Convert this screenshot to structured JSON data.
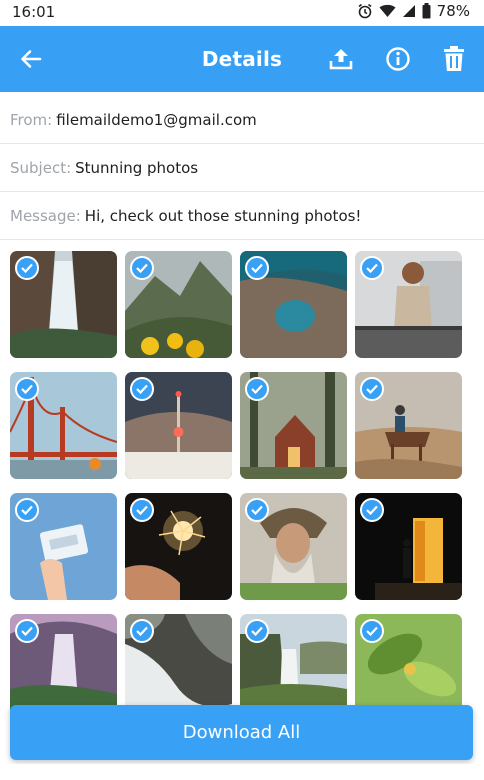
{
  "status_bar": {
    "time": "16:01",
    "battery": "78%",
    "icons": [
      "alarm-icon",
      "wifi-icon",
      "signal-icon",
      "battery-icon"
    ]
  },
  "app_bar": {
    "title": "Details",
    "background": "#37a0f4",
    "icons": [
      "back-arrow-icon",
      "upload-icon",
      "info-icon",
      "trash-icon"
    ]
  },
  "details": {
    "from_label": "From:",
    "from_value": "filemaildemo1@gmail.com",
    "subject_label": "Subject:",
    "subject_value": "Stunning photos",
    "message_label": "Message:",
    "message_value": "Hi, check out those stunning photos!"
  },
  "photos": [
    {
      "subject": "waterfall canyon",
      "selected": true
    },
    {
      "subject": "machu picchu",
      "selected": true
    },
    {
      "subject": "coastal lagoon aerial",
      "selected": true
    },
    {
      "subject": "woman on bridge",
      "selected": true
    },
    {
      "subject": "golden gate bridge",
      "selected": true
    },
    {
      "subject": "tower at dusk",
      "selected": true
    },
    {
      "subject": "cabin in forest",
      "selected": true
    },
    {
      "subject": "horse rider desert",
      "selected": true
    },
    {
      "subject": "hand holding cassette",
      "selected": true
    },
    {
      "subject": "sparkler",
      "selected": true
    },
    {
      "subject": "bearded man headdress",
      "selected": true
    },
    {
      "subject": "man at lit doorway",
      "selected": true
    },
    {
      "subject": "purple waterfall",
      "selected": true
    },
    {
      "subject": "river rapids",
      "selected": true
    },
    {
      "subject": "coastal cliff waterfall",
      "selected": true
    },
    {
      "subject": "green leaves",
      "selected": true
    }
  ],
  "download_button": {
    "label": "Download All",
    "color": "#39a1f5"
  }
}
